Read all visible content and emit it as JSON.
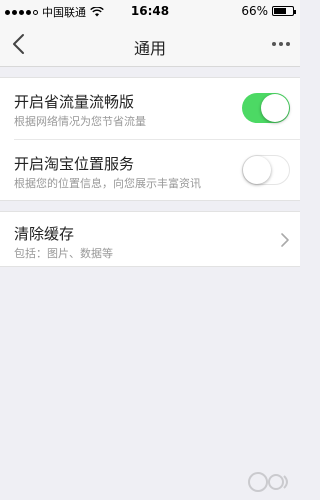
{
  "status_bar": {
    "carrier": "中国联通",
    "time": "16:48",
    "battery": "66%",
    "battery_level": 0.66
  },
  "nav": {
    "title": "通用",
    "back_icon": "chevron-left-icon",
    "more_icon": "more-dots-icon"
  },
  "settings": [
    {
      "title": "开启省流量流畅版",
      "subtitle": "根据网络情况为您节省流量",
      "enabled": true
    },
    {
      "title": "开启淘宝位置服务",
      "subtitle": "根据您的位置信息，向您展示丰富资讯",
      "enabled": false
    }
  ],
  "cache": {
    "title": "清除缓存",
    "subtitle": "包括：图片、数据等"
  },
  "colors": {
    "toggle_on": "#4cd964",
    "background": "#efeff4"
  }
}
